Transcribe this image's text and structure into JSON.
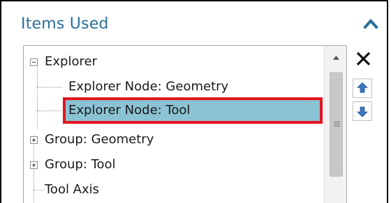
{
  "panel": {
    "title": "Items Used",
    "collapse_icon": "chevron-up-icon",
    "accent_color": "#2a6f96"
  },
  "tree": {
    "items": [
      {
        "label": "Explorer",
        "expander": "minus",
        "level": 0
      },
      {
        "label": "Explorer Node: Geometry",
        "level": 1
      },
      {
        "label": "Explorer Node: Tool",
        "level": 1,
        "selected": true
      },
      {
        "label": "Group: Geometry",
        "expander": "plus",
        "level": 0
      },
      {
        "label": "Group: Tool",
        "expander": "plus",
        "level": 0
      },
      {
        "label": "Tool Axis",
        "level": 0
      }
    ],
    "selection_color": "#8bc2d4",
    "highlight_color": "#e3141e"
  },
  "actions": {
    "remove_icon": "close-icon",
    "move_up_icon": "arrow-up-icon",
    "move_down_icon": "arrow-down-icon"
  }
}
